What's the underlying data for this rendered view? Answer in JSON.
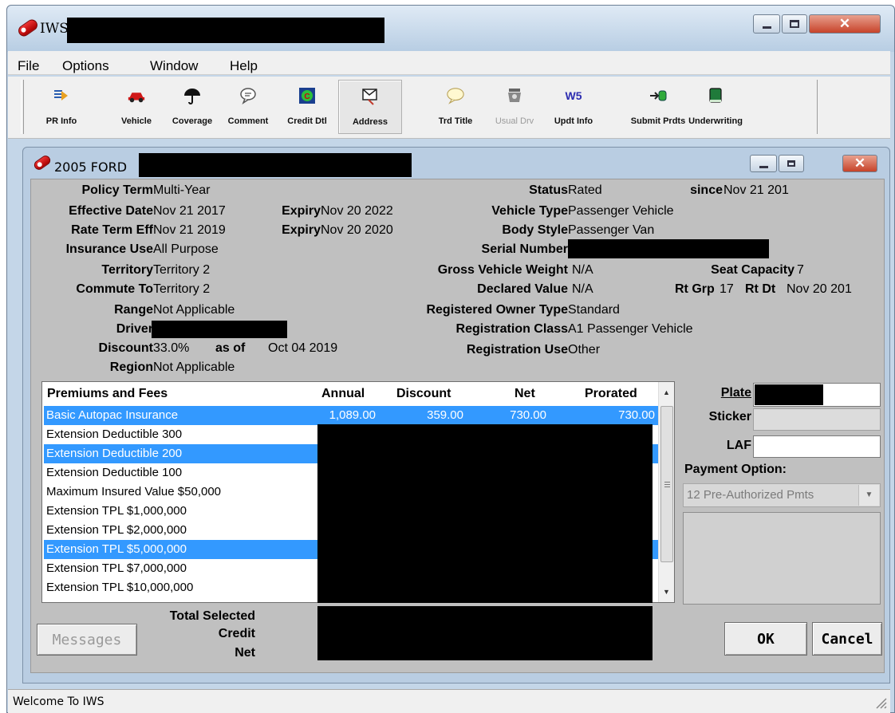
{
  "app": {
    "title": "IWS",
    "menu": [
      "File",
      "Options",
      "Window",
      "Help"
    ],
    "toolbar": [
      {
        "label": "PR Info",
        "icon": "pr-info-icon"
      },
      {
        "label": "Vehicle",
        "icon": "vehicle-icon"
      },
      {
        "label": "Coverage",
        "icon": "umbrella-icon"
      },
      {
        "label": "Comment",
        "icon": "comment-bubble-icon"
      },
      {
        "label": "Credit Dtl",
        "icon": "credit-detail-icon"
      },
      {
        "label": "Address",
        "icon": "address-icon"
      },
      {
        "label": "Trd Title",
        "icon": "trade-title-bubble-icon"
      },
      {
        "label": "Usual Drv",
        "icon": "usual-driver-icon"
      },
      {
        "label": "Updt Info",
        "icon": "w5-update-icon",
        "glyph": "W5"
      },
      {
        "label": "Submit Prdts",
        "icon": "submit-products-icon"
      },
      {
        "label": "Underwriting",
        "icon": "underwriting-book-icon"
      }
    ],
    "status_text": "Welcome To IWS"
  },
  "vehicle_window": {
    "title": "2005 FORD",
    "fields": {
      "policy_term": {
        "label": "Policy Term",
        "value": "Multi-Year"
      },
      "effective_date": {
        "label": "Effective Date",
        "value": "Nov 21 2017"
      },
      "expiry_1": {
        "label": "Expiry",
        "value": "Nov 20 2022"
      },
      "rate_term_eff": {
        "label": "Rate Term Eff",
        "value": "Nov 21 2019"
      },
      "expiry_2": {
        "label": "Expiry",
        "value": "Nov 20 2020"
      },
      "insurance_use": {
        "label": "Insurance Use",
        "value": "All Purpose"
      },
      "territory": {
        "label": "Territory",
        "value": "Territory 2"
      },
      "commute_to": {
        "label": "Commute To",
        "value": "Territory 2"
      },
      "range": {
        "label": "Range",
        "value": "Not Applicable"
      },
      "driver": {
        "label": "Driver",
        "value": ""
      },
      "discount": {
        "label": "Discount",
        "value": "33.0%",
        "as_of_label": "as of",
        "as_of_value": "Oct 04 2019"
      },
      "region": {
        "label": "Region",
        "value": "Not Applicable"
      },
      "status": {
        "label": "Status",
        "value": "Rated"
      },
      "since": {
        "label": "since",
        "value": "Nov 21 201"
      },
      "vehicle_type": {
        "label": "Vehicle Type",
        "value": "Passenger Vehicle"
      },
      "body_style": {
        "label": "Body Style",
        "value": "Passenger Van"
      },
      "serial_number": {
        "label": "Serial Number",
        "value": ""
      },
      "gross_vehicle_weight": {
        "label": "Gross Vehicle Weight",
        "value": "N/A"
      },
      "seat_capacity": {
        "label": "Seat Capacity",
        "value": "7"
      },
      "declared_value": {
        "label": "Declared Value",
        "value": "N/A"
      },
      "rt_grp": {
        "label": "Rt Grp",
        "value": "17"
      },
      "rt_dt": {
        "label": "Rt Dt",
        "value": "Nov 20 201"
      },
      "registered_owner_type": {
        "label": "Registered Owner Type",
        "value": "Standard"
      },
      "registration_class": {
        "label": "Registration Class",
        "value": "A1 Passenger Vehicle"
      },
      "registration_use": {
        "label": "Registration Use",
        "value": "Other"
      }
    },
    "premiums": {
      "columns": [
        "Premiums and Fees",
        "Annual",
        "Discount",
        "Net",
        "Prorated"
      ],
      "rows": [
        {
          "name": "Basic Autopac Insurance",
          "annual": "1,089.00",
          "discount": "359.00",
          "net": "730.00",
          "prorated": "730.00",
          "selected": true
        },
        {
          "name": "Extension Deductible 300",
          "selected": false
        },
        {
          "name": "Extension Deductible 200",
          "selected": true
        },
        {
          "name": "Extension Deductible 100",
          "selected": false
        },
        {
          "name": "Maximum Insured Value $50,000",
          "selected": false
        },
        {
          "name": "Extension TPL $1,000,000",
          "selected": false
        },
        {
          "name": "Extension TPL $2,000,000",
          "selected": false
        },
        {
          "name": "Extension TPL $5,000,000",
          "selected": true
        },
        {
          "name": "Extension TPL $7,000,000",
          "selected": false
        },
        {
          "name": "Extension TPL $10,000,000",
          "selected": false
        }
      ],
      "totals": {
        "total_selected": "Total Selected",
        "credit": "Credit",
        "net": "Net"
      }
    },
    "right_panel": {
      "plate_label": "Plate",
      "plate_value": "",
      "sticker_label": "Sticker",
      "sticker_value": "",
      "laf_label": "LAF",
      "laf_value": "",
      "payment_option_label": "Payment Option:",
      "payment_option_value": "12 Pre-Authorized Pmts"
    },
    "buttons": {
      "messages": "Messages",
      "ok": "OK",
      "cancel": "Cancel"
    }
  }
}
